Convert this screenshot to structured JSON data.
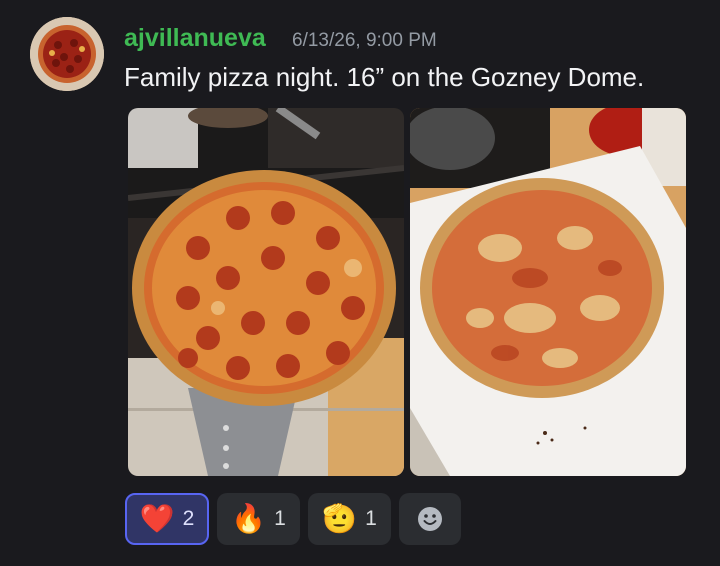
{
  "author": {
    "username": "ajvillanueva",
    "avatar_icon": "pizza-avatar",
    "username_color": "#3fba54"
  },
  "timestamp": "6/13/26, 9:00 PM",
  "message": "Family pizza night. 16” on the Gozney Dome.",
  "attachments": [
    {
      "description_icon": "pepperoni-pizza-photo"
    },
    {
      "description_icon": "cheese-pizza-photo"
    }
  ],
  "reactions": [
    {
      "emoji": "❤️",
      "count": "2",
      "icon": "heart-icon",
      "active": true
    },
    {
      "emoji": "🔥",
      "count": "1",
      "icon": "fire-icon",
      "active": false
    },
    {
      "emoji": "🫡",
      "count": "1",
      "icon": "saluting-face-icon",
      "active": false
    }
  ],
  "add_reaction_icon": "add-reaction-smiley-icon",
  "colors": {
    "background": "#1a1a1e",
    "accent": "#5865f2",
    "reaction_bg": "#2b2d31"
  }
}
